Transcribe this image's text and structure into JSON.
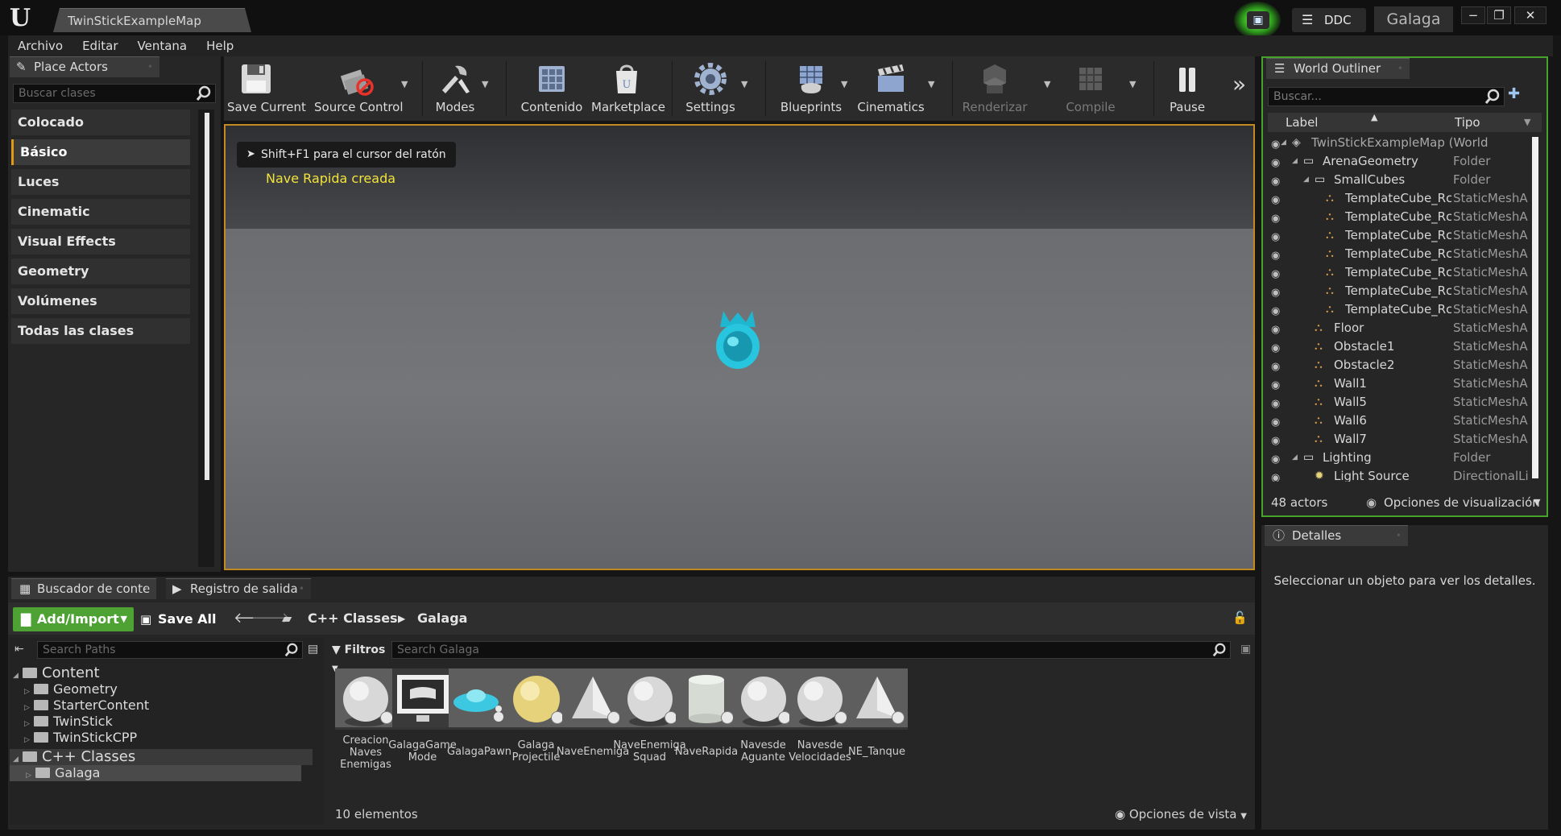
{
  "window": {
    "tab_title": "TwinStickExampleMap",
    "ddc_label": "DDC",
    "project_name": "Galaga",
    "controls": [
      "−",
      "❐",
      "✕"
    ]
  },
  "menu": [
    "Archivo",
    "Editar",
    "Ventana",
    "Help"
  ],
  "place_actors": {
    "tab_label": "Place Actors",
    "search_placeholder": "Buscar clases",
    "categories": [
      "Colocado recientemente",
      "Básico",
      "Luces",
      "Cinematic",
      "Visual Effects",
      "Geometry",
      "Volúmenes",
      "Todas las clases"
    ],
    "active_category": "Básico"
  },
  "toolbar": {
    "buttons": [
      {
        "label": "Save Current",
        "icon": "save-icon",
        "enabled": true
      },
      {
        "label": "Source Control",
        "icon": "source-control-icon",
        "enabled": true
      },
      {
        "label": "Modes",
        "icon": "modes-icon",
        "enabled": true
      },
      {
        "label": "Contenido",
        "icon": "content-icon",
        "enabled": true
      },
      {
        "label": "Marketplace",
        "icon": "marketplace-icon",
        "enabled": true
      },
      {
        "label": "Settings",
        "icon": "settings-icon",
        "enabled": true
      },
      {
        "label": "Blueprints",
        "icon": "blueprints-icon",
        "enabled": true
      },
      {
        "label": "Cinematics",
        "icon": "cinematics-icon",
        "enabled": true
      },
      {
        "label": "Renderizar",
        "icon": "build-icon",
        "enabled": false
      },
      {
        "label": "Compile",
        "icon": "compile-icon",
        "enabled": false
      },
      {
        "label": "Pause",
        "icon": "pause-icon",
        "enabled": true
      }
    ]
  },
  "viewport": {
    "hint": "Shift+F1 para el cursor del ratón",
    "message": "Nave Rapida creada"
  },
  "outliner": {
    "tab_label": "World Outliner",
    "search_placeholder": "Buscar...",
    "col_label": "Label",
    "col_type": "Tipo",
    "rows": [
      {
        "label": "TwinStickExampleMap (World",
        "type": "",
        "depth": 0,
        "kind": "world"
      },
      {
        "label": "ArenaGeometry",
        "type": "Folder",
        "depth": 1,
        "kind": "folder"
      },
      {
        "label": "SmallCubes",
        "type": "Folder",
        "depth": 2,
        "kind": "folder"
      },
      {
        "label": "TemplateCube_Rc",
        "type": "StaticMeshA",
        "depth": 3,
        "kind": "mesh"
      },
      {
        "label": "TemplateCube_Rc",
        "type": "StaticMeshA",
        "depth": 3,
        "kind": "mesh"
      },
      {
        "label": "TemplateCube_Rc",
        "type": "StaticMeshA",
        "depth": 3,
        "kind": "mesh"
      },
      {
        "label": "TemplateCube_Rc",
        "type": "StaticMeshA",
        "depth": 3,
        "kind": "mesh"
      },
      {
        "label": "TemplateCube_Rc",
        "type": "StaticMeshA",
        "depth": 3,
        "kind": "mesh"
      },
      {
        "label": "TemplateCube_Rc",
        "type": "StaticMeshA",
        "depth": 3,
        "kind": "mesh"
      },
      {
        "label": "TemplateCube_Rc",
        "type": "StaticMeshA",
        "depth": 3,
        "kind": "mesh"
      },
      {
        "label": "Floor",
        "type": "StaticMeshA",
        "depth": 2,
        "kind": "mesh"
      },
      {
        "label": "Obstacle1",
        "type": "StaticMeshA",
        "depth": 2,
        "kind": "mesh"
      },
      {
        "label": "Obstacle2",
        "type": "StaticMeshA",
        "depth": 2,
        "kind": "mesh"
      },
      {
        "label": "Wall1",
        "type": "StaticMeshA",
        "depth": 2,
        "kind": "mesh"
      },
      {
        "label": "Wall5",
        "type": "StaticMeshA",
        "depth": 2,
        "kind": "mesh"
      },
      {
        "label": "Wall6",
        "type": "StaticMeshA",
        "depth": 2,
        "kind": "mesh"
      },
      {
        "label": "Wall7",
        "type": "StaticMeshA",
        "depth": 2,
        "kind": "mesh"
      },
      {
        "label": "Lighting",
        "type": "Folder",
        "depth": 1,
        "kind": "folder"
      },
      {
        "label": "Light Source",
        "type": "DirectionalLi",
        "depth": 2,
        "kind": "light"
      }
    ],
    "actor_count": "48 actors",
    "view_options": "Opciones de visualización"
  },
  "details": {
    "tab_label": "Detalles",
    "empty_message": "Seleccionar un objeto para ver los detalles."
  },
  "content_browser": {
    "tab_label": "Buscador de conte",
    "output_tab_label": "Registro de salida",
    "add_import": "Add/Import",
    "save_all": "Save All",
    "breadcrumb": [
      "C++ Classes",
      "Galaga"
    ],
    "paths_placeholder": "Search Paths",
    "tree": [
      {
        "label": "Content",
        "depth": 0,
        "expanded": true
      },
      {
        "label": "Geometry",
        "depth": 1,
        "expanded": false
      },
      {
        "label": "StarterContent",
        "depth": 1,
        "expanded": false
      },
      {
        "label": "TwinStick",
        "depth": 1,
        "expanded": false
      },
      {
        "label": "TwinStickCPP",
        "depth": 1,
        "expanded": false
      },
      {
        "label": "C++ Classes",
        "depth": 0,
        "expanded": true
      },
      {
        "label": "Galaga",
        "depth": 1,
        "expanded": false
      }
    ],
    "filters_label": "Filtros",
    "asset_search_placeholder": "Search Galaga",
    "assets": [
      {
        "name": "Creacion\nNaves\nEnemigas",
        "thumb": "sphere"
      },
      {
        "name": "GalagaGame\nMode",
        "thumb": "gamemode"
      },
      {
        "name": "GalagaPawn",
        "thumb": "pawn"
      },
      {
        "name": "Galaga\nProjectile",
        "thumb": "yellow-sphere"
      },
      {
        "name": "NaveEnemiga",
        "thumb": "pyramid"
      },
      {
        "name": "NaveEnemiga\nSquad",
        "thumb": "sphere"
      },
      {
        "name": "NaveRapida",
        "thumb": "cylinder"
      },
      {
        "name": "Navesde\nAguante",
        "thumb": "sphere"
      },
      {
        "name": "Navesde\nVelocidades",
        "thumb": "sphere"
      },
      {
        "name": "NE_Tanque",
        "thumb": "pyramid"
      }
    ],
    "item_count": "10 elementos",
    "view_options": "Opciones de vista"
  },
  "colors": {
    "accent_orange": "#e09a16",
    "outliner_border_green": "#46a22a",
    "add_button_green": "#4da233",
    "viewport_message_yellow": "#f2e33a"
  }
}
